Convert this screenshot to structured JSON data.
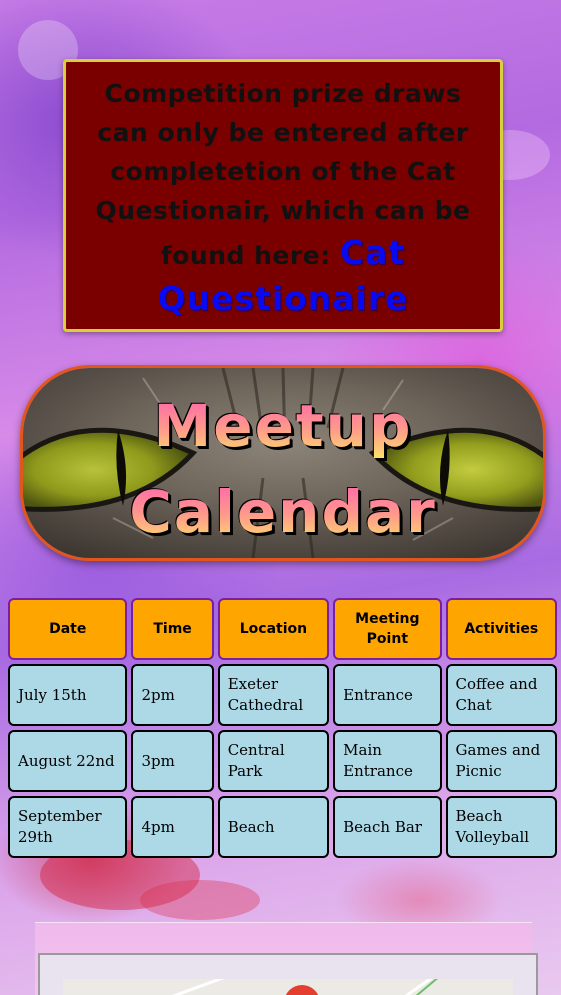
{
  "notice": {
    "text": "Competition prize draws can only be entered after completetion of the Cat Questionair, which can be found here: ",
    "link_label": "Cat Questionaire",
    "background": "#7a0000",
    "link_color": "#0a0af0"
  },
  "banner": {
    "line1": "Meetup",
    "line2": "Calendar"
  },
  "calendar": {
    "headers": [
      "Date",
      "Time",
      "Location",
      "Meeting Point",
      "Activities"
    ],
    "rows": [
      [
        "July 15th",
        "2pm",
        "Exeter Cathedral",
        "Entrance",
        "Coffee and Chat"
      ],
      [
        "August 22nd",
        "3pm",
        "Central Park",
        "Main Entrance",
        "Games and Picnic"
      ],
      [
        "September 29th",
        "4pm",
        "Beach",
        "Beach Bar",
        "Beach Volleyball"
      ]
    ],
    "header_color": "#ffa500",
    "cell_color": "#add8e6"
  },
  "map": {
    "icon": "map-pin-icon"
  }
}
